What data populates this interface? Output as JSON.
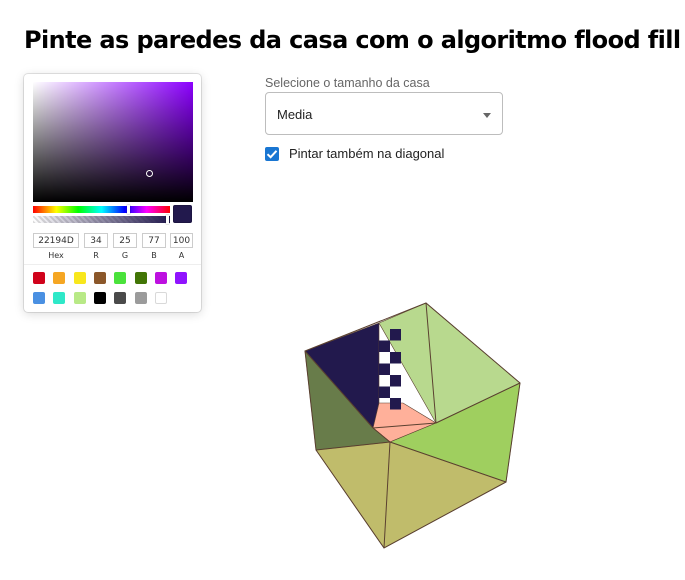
{
  "page": {
    "title": "Pinte as paredes da casa com o algoritmo flood fill"
  },
  "color_picker": {
    "hue_color": "#8c00ff",
    "selected_color": "#22194D",
    "fields": [
      {
        "value": "22194D",
        "label": "Hex"
      },
      {
        "value": "34",
        "label": "R"
      },
      {
        "value": "25",
        "label": "G"
      },
      {
        "value": "77",
        "label": "B"
      },
      {
        "value": "100",
        "label": "A"
      }
    ],
    "presets": [
      "#d0021b",
      "#f5a623",
      "#f8e71c",
      "#8b572a",
      "#4ae23b",
      "#417505",
      "#bd10e0",
      "#9013fe",
      "#4a90e2",
      "#2ee8c8",
      "#b8e986",
      "#000000",
      "#4a4a4a",
      "#9b9b9b",
      "#ffffff"
    ]
  },
  "house_size": {
    "label": "Selecione o tamanho da casa",
    "value": "Media"
  },
  "diagonal": {
    "checked": true,
    "label": "Pintar também na diagonal"
  },
  "cube": {
    "colors": {
      "left_back": "#22194D",
      "right_back": "#b8d98e",
      "floor": "#ffb09a",
      "left_front": "#687c4a",
      "right_front": "#9fcf5f",
      "bottom_front": "#c0bc6b",
      "edge": "#5a4030"
    }
  }
}
